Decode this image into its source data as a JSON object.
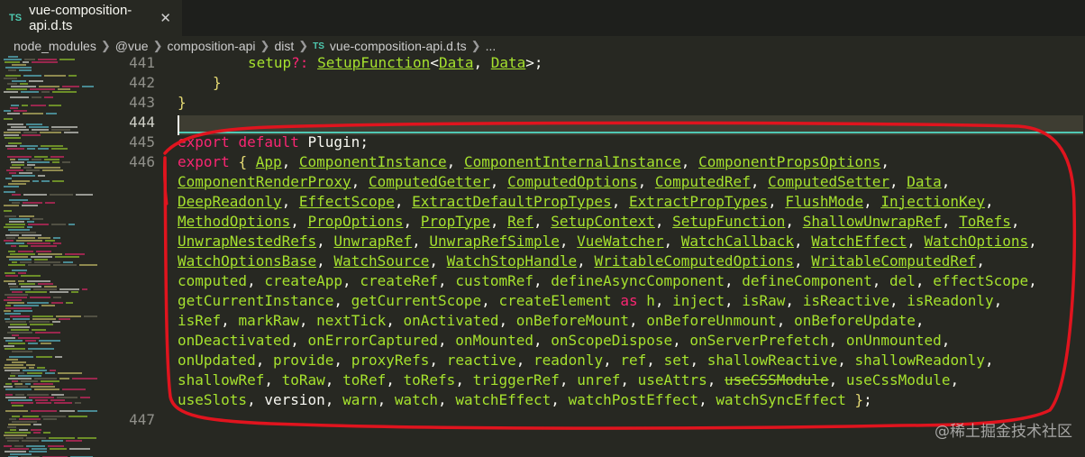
{
  "tab": {
    "badge": "TS",
    "title": "vue-composition-api.d.ts",
    "close": "✕"
  },
  "breadcrumb": {
    "items": [
      "node_modules",
      "@vue",
      "composition-api",
      "dist"
    ],
    "file_badge": "TS",
    "file": "vue-composition-api.d.ts",
    "trail": "..."
  },
  "gutter": [
    "441",
    "442",
    "443",
    "444",
    "445",
    "446",
    "447"
  ],
  "code": {
    "line_441": "setup?: SetupFunction<Data, Data>;",
    "line_442": "}",
    "line_443": "}",
    "line_445": {
      "kw1": "export",
      "kw2": "default",
      "name": "Plugin",
      "end": ";"
    },
    "line_446": [
      "export { App, ComponentInstance, ComponentInternalInstance, ComponentPropsOptions,",
      "ComponentRenderProxy, ComputedGetter, ComputedOptions, ComputedRef, ComputedSetter, Data,",
      "DeepReadonly, EffectScope, ExtractDefaultPropTypes, ExtractPropTypes, FlushMode, InjectionKey,",
      "MethodOptions, PropOptions, PropType, Ref, SetupContext, SetupFunction, ShallowUnwrapRef, ToRefs,",
      "UnwrapNestedRefs, UnwrapRef, UnwrapRefSimple, VueWatcher, WatchCallback, WatchEffect, WatchOptions,",
      "WatchOptionsBase, WatchSource, WatchStopHandle, WritableComputedOptions, WritableComputedRef,",
      "computed, createApp, createRef, customRef, defineAsyncComponent, defineComponent, del, effectScope,",
      "getCurrentInstance, getCurrentScope, createElement as h, inject, isRaw, isReactive, isReadonly,",
      "isRef, markRaw, nextTick, onActivated, onBeforeMount, onBeforeUnmount, onBeforeUpdate,",
      "onDeactivated, onErrorCaptured, onMounted, onScopeDispose, onServerPrefetch, onUnmounted,",
      "onUpdated, provide, proxyRefs, reactive, readonly, ref, set, shallowReactive, shallowReadonly,",
      "shallowRef, toRaw, toRef, toRefs, triggerRef, unref, useAttrs, useCSSModule, useCssModule,",
      "useSlots, version, warn, watch, watchEffect, watchPostEffect, watchSyncEffect };"
    ]
  },
  "watermark": "@稀土掘金技术社区",
  "colors": {
    "background": "#272822",
    "keyword": "#f92672",
    "type": "#a6e22e",
    "bracket": "#e6db74",
    "annotation": "#e0141e"
  }
}
